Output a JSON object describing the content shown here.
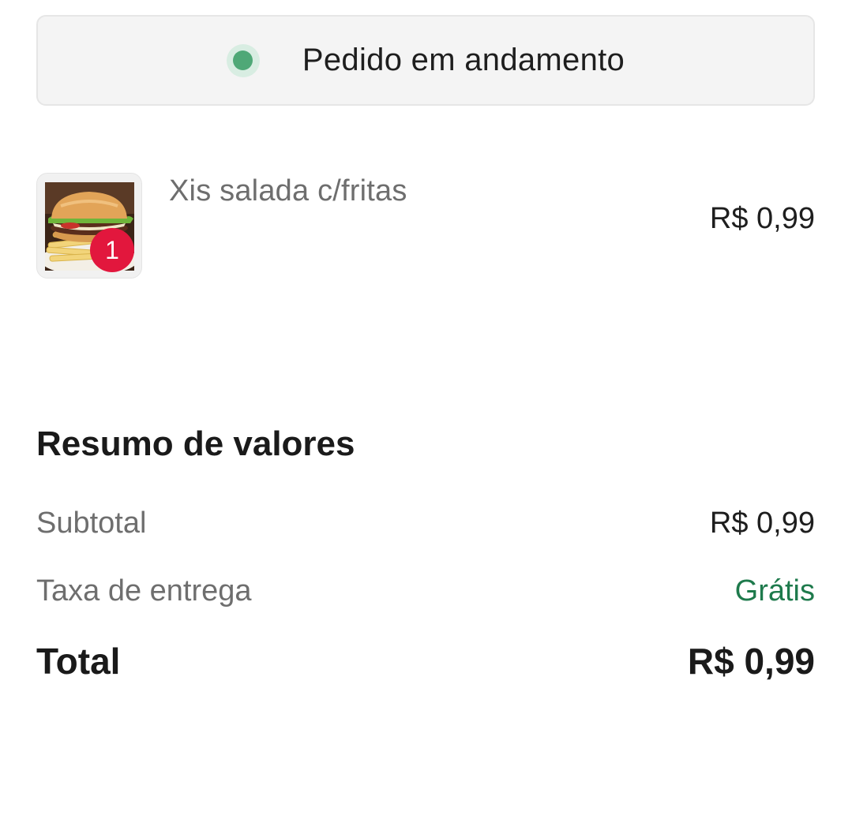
{
  "status": {
    "text": "Pedido em andamento",
    "indicator_color": "#4fa877"
  },
  "order_items": [
    {
      "name": "Xis salada c/fritas",
      "price": "R$ 0,99",
      "quantity": "1",
      "image_icon": "burger-with-fries-photo"
    }
  ],
  "summary": {
    "title": "Resumo de valores",
    "subtotal_label": "Subtotal",
    "subtotal_value": "R$ 0,99",
    "delivery_label": "Taxa de entrega",
    "delivery_value": "Grátis",
    "total_label": "Total",
    "total_value": "R$ 0,99"
  },
  "colors": {
    "badge": "#e2173d",
    "free_delivery": "#1e7a4c"
  }
}
